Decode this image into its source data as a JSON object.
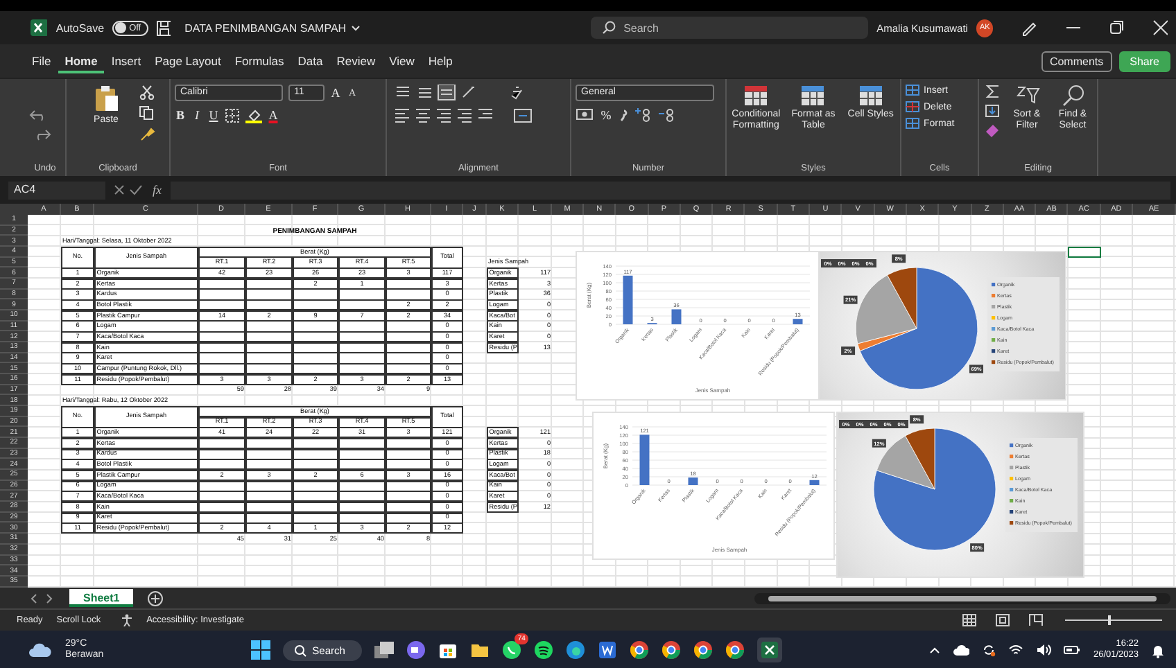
{
  "title_bar": {
    "autosave_label": "AutoSave",
    "autosave_state": "Off",
    "autosave_on": false,
    "file_name": "DATA PENIMBANGAN SAMPAH",
    "search_placeholder": "Search",
    "user_name": "Amalia Kusumawati",
    "user_initials": "AK"
  },
  "menu_tabs": [
    {
      "label": "File",
      "selected": false
    },
    {
      "label": "Home",
      "selected": true
    },
    {
      "label": "Insert",
      "selected": false
    },
    {
      "label": "Page Layout",
      "selected": false
    },
    {
      "label": "Formulas",
      "selected": false
    },
    {
      "label": "Data",
      "selected": false
    },
    {
      "label": "Review",
      "selected": false
    },
    {
      "label": "View",
      "selected": false
    },
    {
      "label": "Help",
      "selected": false
    }
  ],
  "menu_buttons": [
    "Comments",
    "Share"
  ],
  "ribbon": {
    "undo": {
      "label": "Undo"
    },
    "clipboard": {
      "label": "Clipboard",
      "paste": "Paste"
    },
    "font": {
      "label": "Font",
      "family": "Calibri",
      "size": "11",
      "grow_font": "A",
      "shrink_font": "A",
      "bold": "B",
      "italic": "I",
      "underline": "U",
      "font_color": "A"
    },
    "alignment": {
      "label": "Alignment"
    },
    "number": {
      "label": "Number",
      "format": "General",
      "percent": "%"
    },
    "styles": {
      "label": "Styles",
      "buttons": [
        "Conditional Formatting",
        "Format as Table",
        "Cell Styles"
      ]
    },
    "cells": {
      "label": "Cells",
      "buttons": [
        "Insert",
        "Delete",
        "Format"
      ]
    },
    "editing": {
      "label": "Editing",
      "buttons": [
        "Sort & Filter",
        "Find & Select"
      ]
    }
  },
  "formula_bar": {
    "name_box": "AC4",
    "fx": "fx"
  },
  "sheet": {
    "column_headers": [
      "A",
      "B",
      "C",
      "D",
      "E",
      "F",
      "G",
      "H",
      "I",
      "J",
      "K",
      "L",
      "M",
      "N",
      "O",
      "P",
      "Q",
      "R",
      "S",
      "T",
      "U",
      "V",
      "W",
      "X",
      "Y",
      "Z",
      "AA",
      "AB",
      "AC",
      "AD",
      "AE"
    ],
    "row_headers": [
      "1",
      "2",
      "3",
      "4",
      "5",
      "6",
      "7",
      "8",
      "9",
      "10",
      "11",
      "12",
      "13",
      "14",
      "15",
      "16",
      "17",
      "18",
      "19",
      "20",
      "21",
      "22",
      "23",
      "24",
      "25",
      "26",
      "27",
      "28",
      "29",
      "30",
      "31",
      "32",
      "33",
      "34",
      "35"
    ],
    "title": "PENIMBANGAN SAMPAH",
    "tables": [
      {
        "date": "Hari/Tanggal: Selasa, 11 Oktober 2022",
        "header": {
          "no": "No.",
          "type": "Jenis Sampah",
          "weight": "Berat (Kg)",
          "units": [
            "RT.1",
            "RT.2",
            "RT.3",
            "RT.4",
            "RT.5"
          ],
          "total": "Total"
        },
        "rows": [
          {
            "no": "1",
            "name": "Organik",
            "rt1": "42",
            "rt2": "23",
            "rt3": "26",
            "rt4": "23",
            "rt5": "3",
            "total": "117"
          },
          {
            "no": "2",
            "name": "Kertas",
            "rt3": "2",
            "rt4": "1",
            "total": "3"
          },
          {
            "no": "3",
            "name": "Kardus",
            "total": "0"
          },
          {
            "no": "4",
            "name": "Botol Plastik",
            "rt5": "2",
            "total": "2"
          },
          {
            "no": "5",
            "name": "Plastik Campur",
            "rt1": "14",
            "rt2": "2",
            "rt3": "9",
            "rt4": "7",
            "rt5": "2",
            "total": "34"
          },
          {
            "no": "6",
            "name": "Logam",
            "total": "0"
          },
          {
            "no": "7",
            "name": "Kaca/Botol Kaca",
            "total": "0"
          },
          {
            "no": "8",
            "name": "Kain",
            "total": "0"
          },
          {
            "no": "9",
            "name": "Karet",
            "total": "0"
          },
          {
            "no": "10",
            "name": "Campur (Puntung Rokok, Dll.)",
            "total": "0"
          },
          {
            "no": "11",
            "name": "Residu (Popok/Pembalut)",
            "rt1": "3",
            "rt2": "3",
            "rt3": "2",
            "rt4": "3",
            "rt5": "2",
            "total": "13"
          }
        ],
        "sums": [
          "59",
          "28",
          "39",
          "34",
          "9"
        ],
        "summary": {
          "title": "Jenis Sampah",
          "rows": [
            {
              "name": "Organik",
              "value": "117"
            },
            {
              "name": "Kertas",
              "value": "3"
            },
            {
              "name": "Plastik",
              "value": "36"
            },
            {
              "name": "Logam",
              "value": "0"
            },
            {
              "name": "Kaca/Bot",
              "value": "0"
            },
            {
              "name": "Kain",
              "value": "0"
            },
            {
              "name": "Karet",
              "value": "0"
            },
            {
              "name": "Residu (P",
              "value": "13"
            }
          ]
        }
      },
      {
        "date": "Hari/Tanggal: Rabu, 12 Oktober 2022",
        "header": {
          "no": "No.",
          "type": "Jenis Sampah",
          "weight": "Berat (Kg)",
          "units": [
            "RT.1",
            "RT.2",
            "RT.3",
            "RT.4",
            "RT.5"
          ],
          "total": "Total"
        },
        "rows": [
          {
            "no": "1",
            "name": "Organik",
            "rt1": "41",
            "rt2": "24",
            "rt3": "22",
            "rt4": "31",
            "rt5": "3",
            "total": "121"
          },
          {
            "no": "2",
            "name": "Kertas",
            "total": "0"
          },
          {
            "no": "3",
            "name": "Kardus",
            "total": "0"
          },
          {
            "no": "4",
            "name": "Botol Plastik",
            "total": "0"
          },
          {
            "no": "5",
            "name": "Plastik Campur",
            "rt1": "2",
            "rt2": "3",
            "rt3": "2",
            "rt4": "6",
            "rt5": "3",
            "total": "16"
          },
          {
            "no": "6",
            "name": "Logam",
            "total": "0"
          },
          {
            "no": "7",
            "name": "Kaca/Botol Kaca",
            "total": "0"
          },
          {
            "no": "8",
            "name": "Kain",
            "total": "0"
          },
          {
            "no": "9",
            "name": "Karet",
            "total": "0"
          },
          {
            "no": "11",
            "name": "Residu (Popok/Pembalut)",
            "rt1": "2",
            "rt2": "4",
            "rt3": "1",
            "rt4": "3",
            "rt5": "2",
            "total": "12"
          }
        ],
        "sums": [
          "45",
          "31",
          "25",
          "40",
          "8"
        ],
        "summary": {
          "rows": [
            {
              "name": "Organik",
              "value": "121"
            },
            {
              "name": "Kertas",
              "value": "0"
            },
            {
              "name": "Plastik",
              "value": "18"
            },
            {
              "name": "Logam",
              "value": "0"
            },
            {
              "name": "Kaca/Bot",
              "value": "0"
            },
            {
              "name": "Kain",
              "value": "0"
            },
            {
              "name": "Karet",
              "value": "0"
            },
            {
              "name": "Residu (P",
              "value": "12"
            }
          ]
        }
      }
    ],
    "charts": [
      {
        "chart_data": {
          "type": "bar",
          "xlabel": "Jenis Sampah",
          "ylabel": "Berat (Kg)",
          "categories": [
            "Organik",
            "Kertas",
            "Plastik",
            "Logam",
            "Kaca/Botol Kaca",
            "Kain",
            "Karet",
            "Residu (Popok/Pembalut)"
          ],
          "values": [
            117,
            3,
            36,
            0,
            0,
            0,
            0,
            13
          ],
          "ylim": [
            0,
            140
          ],
          "yticks": [
            0,
            20,
            40,
            60,
            80,
            100,
            120,
            140
          ],
          "grid": true,
          "data_labels": true
        }
      },
      {
        "chart_data": {
          "type": "pie",
          "categories": [
            "Organik",
            "Kertas",
            "Plastik",
            "Logam",
            "Kaca/Botol Kaca",
            "Kain",
            "Karet",
            "Residu (Popok/Pembalut)"
          ],
          "values": [
            69,
            2,
            21,
            0,
            0,
            0,
            0,
            8
          ],
          "value_labels": [
            "69%",
            "2%",
            "21%",
            "0%",
            "0%",
            "0%",
            "0%",
            "8%"
          ],
          "legend": "right"
        }
      },
      {
        "chart_data": {
          "type": "bar",
          "xlabel": "Jenis Sampah",
          "ylabel": "Berat (Kg)",
          "categories": [
            "Organik",
            "Kertas",
            "Plastik",
            "Logam",
            "Kaca/Botol Kaca",
            "Kain",
            "Karet",
            "Residu (Popok/Pembalut)"
          ],
          "values": [
            121,
            0,
            18,
            0,
            0,
            0,
            0,
            12
          ],
          "ylim": [
            0,
            140
          ],
          "yticks": [
            0,
            20,
            40,
            60,
            80,
            100,
            120,
            140
          ],
          "grid": true,
          "data_labels": true
        }
      },
      {
        "chart_data": {
          "type": "pie",
          "categories": [
            "Organik",
            "Kertas",
            "Plastik",
            "Logam",
            "Kaca/Botol Kaca",
            "Kain",
            "Karet",
            "Residu (Popok/Pembalut)"
          ],
          "values": [
            80,
            0,
            12,
            0,
            0,
            0,
            0,
            8
          ],
          "value_labels": [
            "80%",
            "0%",
            "12%",
            "0%",
            "0%",
            "0%",
            "0%",
            "8%"
          ],
          "legend": "right"
        }
      }
    ]
  },
  "sheet_tabs": [
    {
      "label": "Sheet1",
      "selected": true
    }
  ],
  "status_bar": {
    "ready": "Ready",
    "scroll_lock": "Scroll Lock",
    "accessibility": "Accessibility: Investigate",
    "zoom_slider": {
      "level": 0.45
    }
  },
  "taskbar": {
    "temperature": "29°C",
    "weather": "Berawan",
    "search": "Search",
    "badge": "74",
    "time": "16:22",
    "date": "26/01/2023"
  }
}
